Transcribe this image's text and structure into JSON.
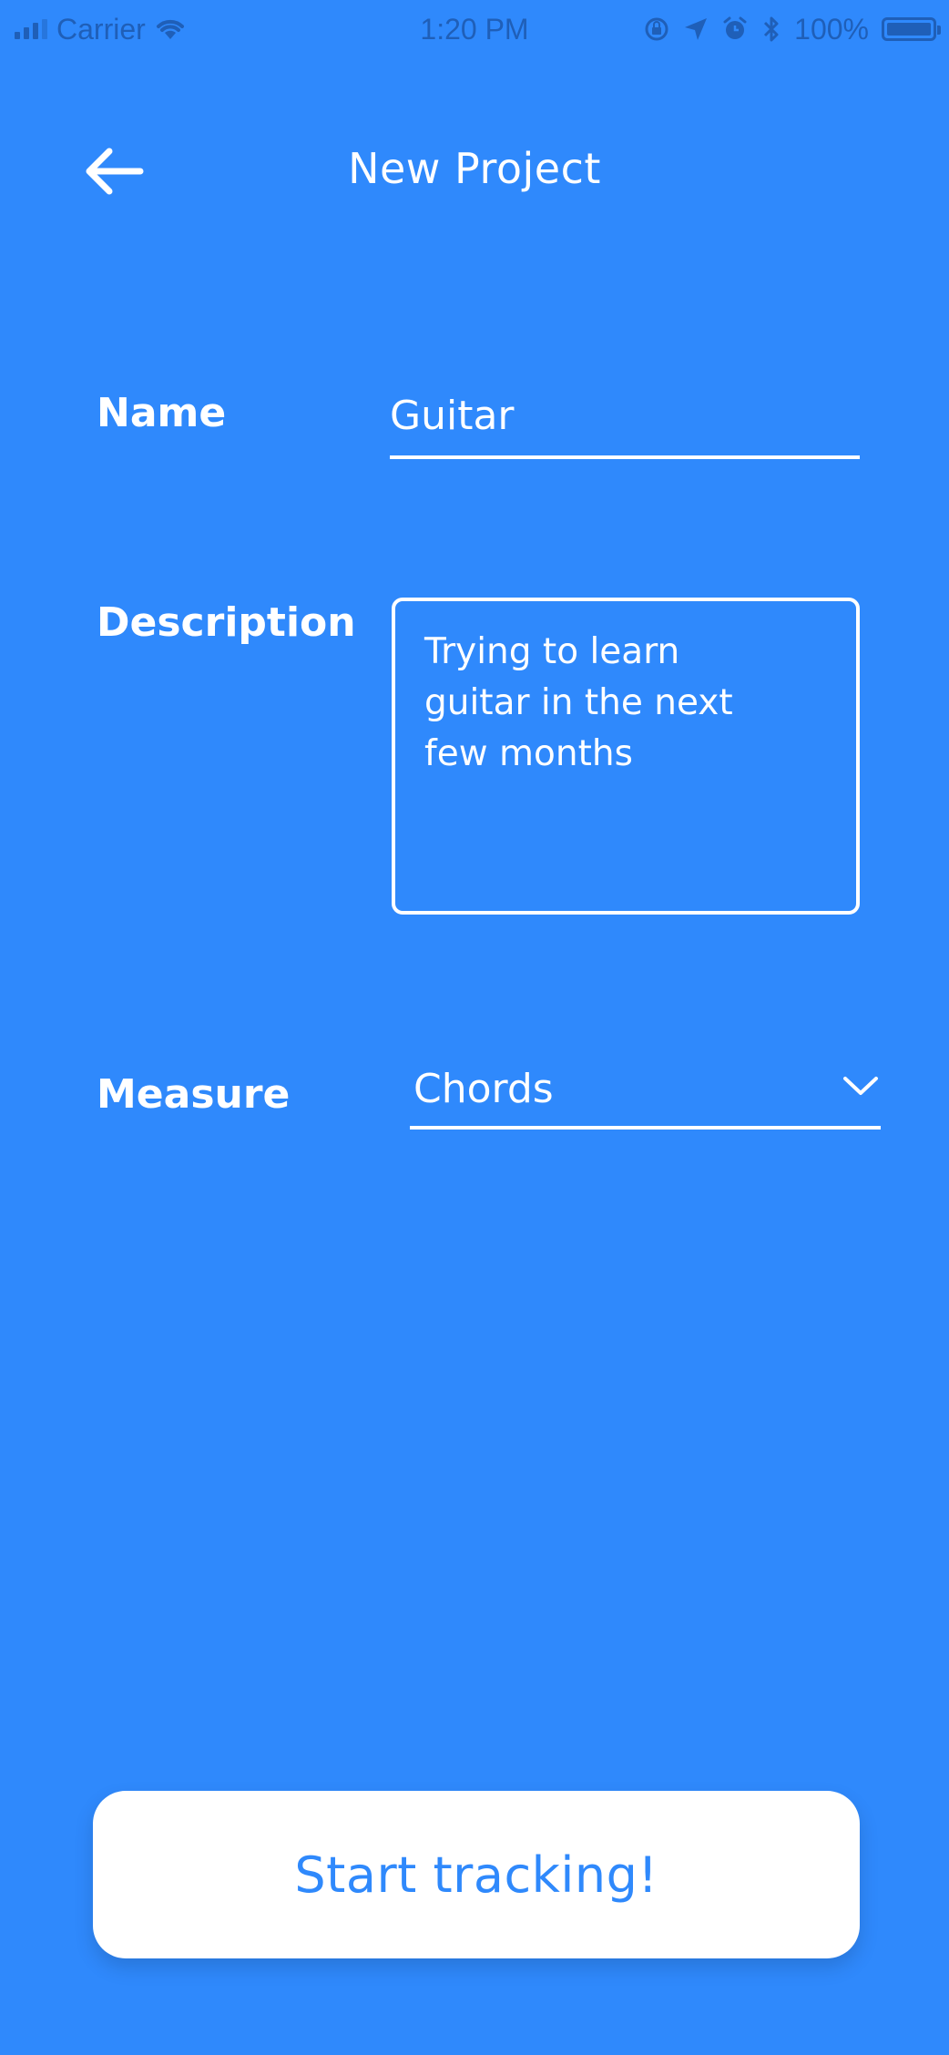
{
  "status_bar": {
    "carrier": "Carrier",
    "time": "1:20 PM",
    "battery_percent": "100%",
    "icons": [
      "signal-icon",
      "wifi-icon",
      "orientation-lock-icon",
      "location-icon",
      "alarm-icon",
      "bluetooth-icon",
      "battery-icon"
    ]
  },
  "header": {
    "title": "New Project",
    "back_icon": "arrow-left-icon"
  },
  "form": {
    "name": {
      "label": "Name",
      "value": "Guitar"
    },
    "description": {
      "label": "Description",
      "value": "Trying to learn guitar in the next few months"
    },
    "measure": {
      "label": "Measure",
      "selected": "Chords",
      "icon": "chevron-down-icon"
    }
  },
  "actions": {
    "start_label": "Start tracking!"
  },
  "colors": {
    "background": "#2F89FC",
    "foreground": "#FFFFFF",
    "status_bar_text": "#1F5FB8",
    "button_background": "#FFFFFF",
    "button_text": "#2F89FC"
  }
}
